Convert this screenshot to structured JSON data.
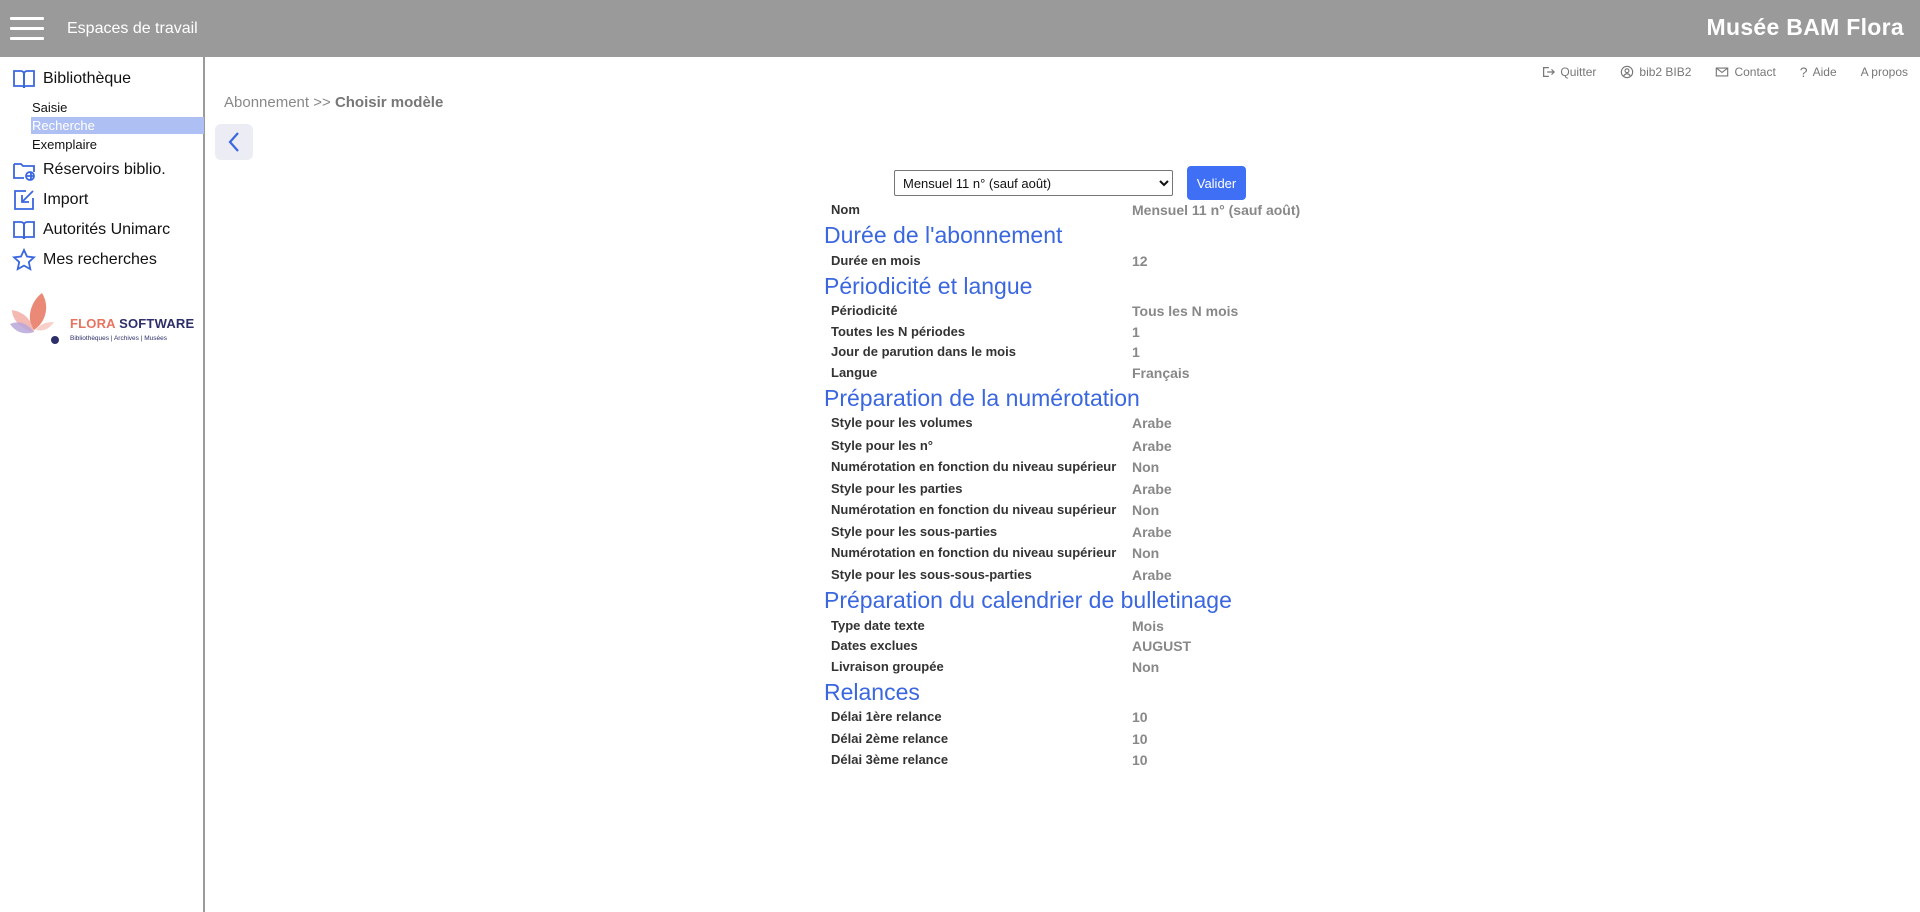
{
  "header": {
    "workspaces_label": "Espaces de travail",
    "app_title": "Musée BAM Flora"
  },
  "sidebar": {
    "items": [
      {
        "label": "Bibliothèque",
        "icon": "book-open-icon"
      },
      {
        "label": "Réservoirs biblio.",
        "icon": "folder-globe-icon"
      },
      {
        "label": "Import",
        "icon": "import-arrow-icon"
      },
      {
        "label": "Autorités Unimarc",
        "icon": "book-open-icon"
      },
      {
        "label": "Mes recherches",
        "icon": "star-icon"
      }
    ],
    "subitems": [
      {
        "label": "Saisie"
      },
      {
        "label": "Recherche",
        "active": true
      },
      {
        "label": "Exemplaire"
      }
    ],
    "logo": {
      "brand_part1": "FLORA",
      "brand_part2": "SOFTWARE",
      "tagline": "Bibliothèques | Archives | Musées"
    }
  },
  "toplinks": {
    "quit": "Quitter",
    "user": "bib2 BIB2",
    "contact": "Contact",
    "help": "Aide",
    "about": "A propos"
  },
  "breadcrumb": {
    "parent": "Abonnement >>",
    "current": "Choisir modèle"
  },
  "form": {
    "selected_model": "Mensuel 11 n° (sauf août)",
    "validate_label": "Valider"
  },
  "details": {
    "nom_label": "Nom",
    "nom_value": "Mensuel 11 n° (sauf août)",
    "sections": [
      {
        "title": "Durée de l'abonnement",
        "rows": [
          {
            "label": "Durée en mois",
            "value": "12"
          }
        ]
      },
      {
        "title": "Périodicité et langue",
        "rows": [
          {
            "label": "Périodicité",
            "value": "Tous les N mois"
          },
          {
            "label": "Toutes les N périodes",
            "value": "1"
          },
          {
            "label": "Jour de parution dans le mois",
            "value": "1"
          },
          {
            "label": "Langue",
            "value": "Français"
          }
        ]
      },
      {
        "title": "Préparation de la numérotation",
        "rows": [
          {
            "label": "Style pour les volumes",
            "value": "Arabe"
          },
          {
            "label": "Style pour les n°",
            "value": "Arabe"
          },
          {
            "label": "Numérotation en fonction du niveau supérieur",
            "value": "Non"
          },
          {
            "label": "Style pour les parties",
            "value": "Arabe"
          },
          {
            "label": "Numérotation en fonction du niveau supérieur",
            "value": "Non"
          },
          {
            "label": "Style pour les sous-parties",
            "value": "Arabe"
          },
          {
            "label": "Numérotation en fonction du niveau supérieur",
            "value": "Non"
          },
          {
            "label": "Style pour les sous-sous-parties",
            "value": "Arabe"
          }
        ]
      },
      {
        "title": "Préparation du calendrier de bulletinage",
        "rows": [
          {
            "label": "Type date texte",
            "value": "Mois"
          },
          {
            "label": "Dates exclues",
            "value": "AUGUST"
          },
          {
            "label": "Livraison groupée",
            "value": "Non"
          }
        ]
      },
      {
        "title": "Relances",
        "rows": [
          {
            "label": "Délai 1ère relance",
            "value": "10"
          },
          {
            "label": "Délai 2ème relance",
            "value": "10"
          },
          {
            "label": "Délai 3ème relance",
            "value": "10"
          }
        ]
      }
    ]
  },
  "colors": {
    "topbar": "#9a9a9a",
    "accent": "#3a67e0",
    "button": "#3f6ff5",
    "active_sub": "#aebff4"
  }
}
